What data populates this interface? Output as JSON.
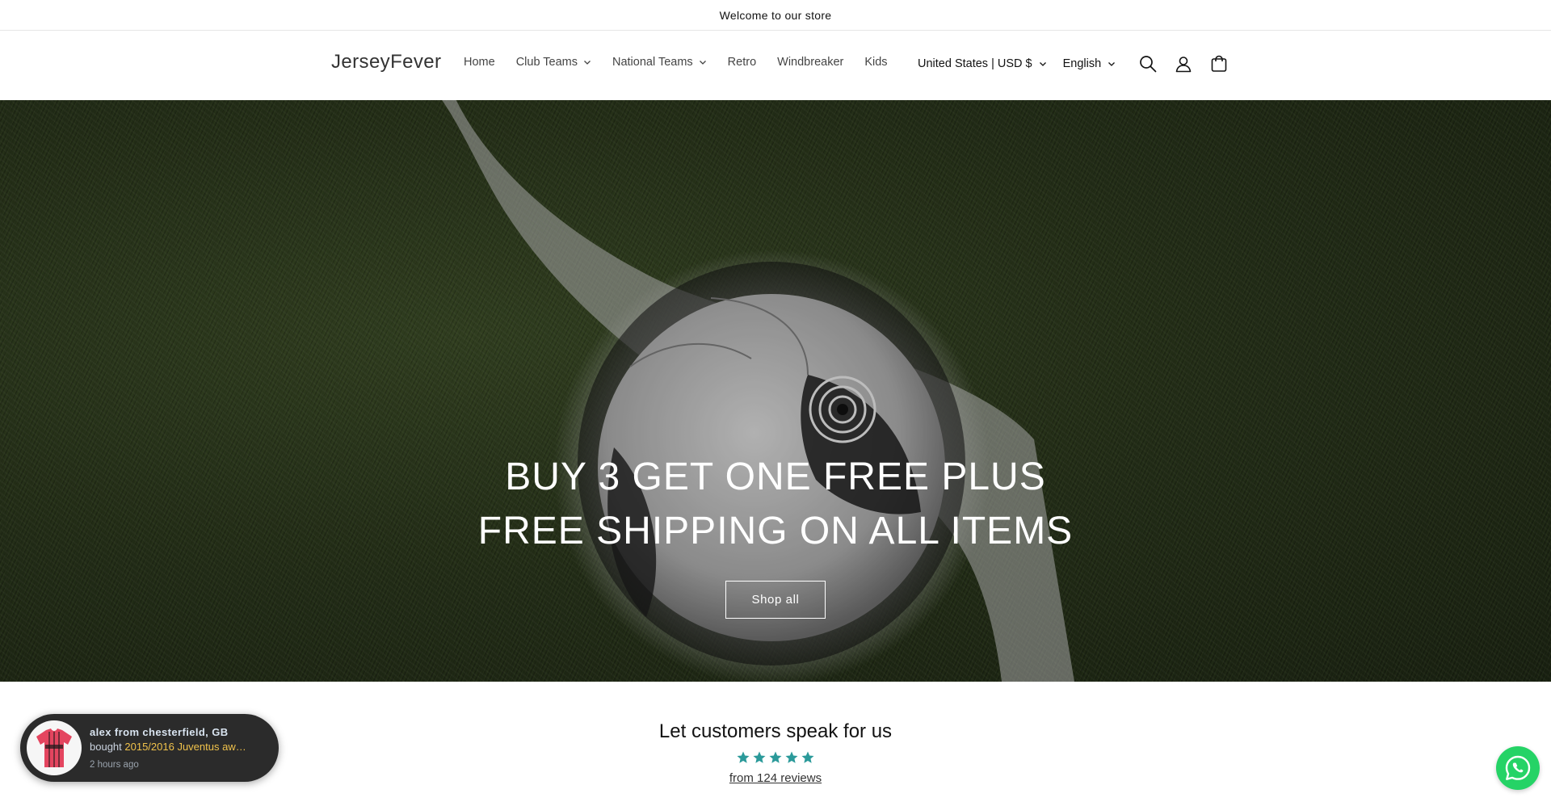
{
  "announcement": {
    "text": "Welcome to our store"
  },
  "header": {
    "logo": "JerseyFever",
    "nav": [
      {
        "label": "Home",
        "has_dropdown": false
      },
      {
        "label": "Club Teams",
        "has_dropdown": true
      },
      {
        "label": "National Teams",
        "has_dropdown": true
      },
      {
        "label": "Retro",
        "has_dropdown": false
      },
      {
        "label": "Windbreaker",
        "has_dropdown": false
      },
      {
        "label": "Kids",
        "has_dropdown": false
      }
    ],
    "country": "United States | USD $",
    "language": "English",
    "icons": [
      "search-icon",
      "account-icon",
      "cart-icon"
    ]
  },
  "hero": {
    "title": "BUY 3 GET ONE FREE PLUS FREE SHIPPING ON ALL ITEMS",
    "button": "Shop all"
  },
  "reviews": {
    "heading": "Let customers speak for us",
    "rating": 5,
    "star_color": "#2b9a9a",
    "link": "from 124 reviews"
  },
  "purchase_popup": {
    "who": "alex from chesterfield, GB",
    "prefix": "bought",
    "product": "2015/2016 Juventus aw…",
    "when": "2 hours ago"
  },
  "whatsapp": {
    "icon": "whatsapp-icon",
    "color": "#25d366"
  }
}
